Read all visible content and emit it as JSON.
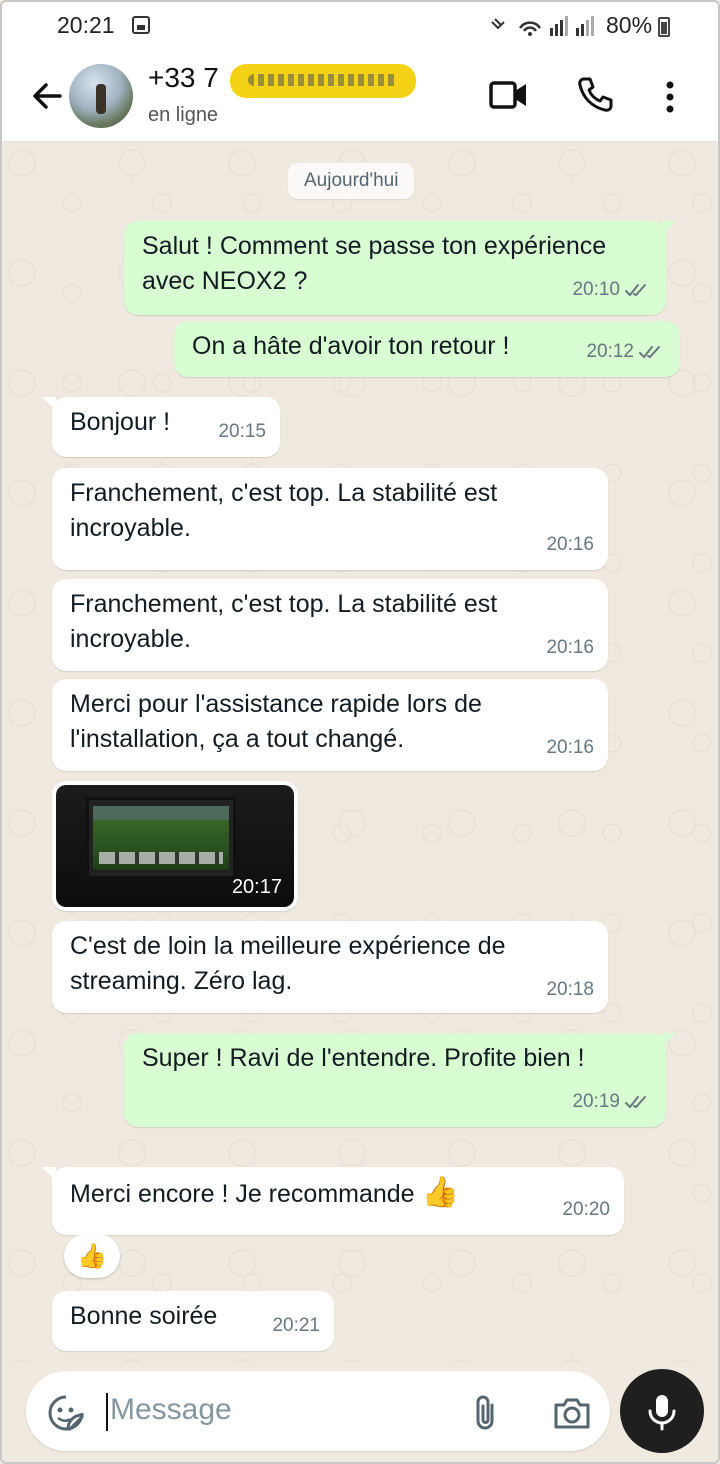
{
  "status_bar": {
    "time": "20:21",
    "battery_pct": "80%",
    "icons": [
      "gallery-icon",
      "mute-icon",
      "wifi-icon",
      "signal-icon",
      "battery-icon"
    ]
  },
  "header": {
    "contact_prefix": "+33 7",
    "status": "en ligne",
    "icons": [
      "back-arrow-icon",
      "video-call-icon",
      "phone-call-icon",
      "more-options-icon"
    ]
  },
  "chat": {
    "date_separator": "Aujourd'hui",
    "messages": [
      {
        "direction": "out",
        "text": "Salut ! Comment se passe ton expérience avec NEOX2 ?",
        "time": "20:10",
        "status": "read"
      },
      {
        "direction": "out",
        "text": "On a hâte d'avoir ton retour !",
        "time": "20:12",
        "status": "read"
      },
      {
        "direction": "in",
        "text": "Bonjour !",
        "time": "20:15"
      },
      {
        "direction": "in",
        "text": "Franchement, c'est top. La stabilité est incroyable.",
        "time": "20:16"
      },
      {
        "direction": "in",
        "text": "Franchement, c'est top. La stabilité est incroyable.",
        "time": "20:16"
      },
      {
        "direction": "in",
        "text": "Merci pour l'assistance rapide lors de l'installation, ça a tout changé.",
        "time": "20:16"
      },
      {
        "direction": "in",
        "type": "image",
        "time": "20:17"
      },
      {
        "direction": "in",
        "text": "C'est de loin la meilleure expérience de streaming. Zéro lag.",
        "time": "20:18"
      },
      {
        "direction": "out",
        "text": "Super ! Ravi de l'entendre. Profite bien !",
        "time": "20:19",
        "status": "read"
      },
      {
        "direction": "in",
        "text": "Merci encore ! Je recommande",
        "emoji": "👍",
        "time": "20:20",
        "reaction": "👍"
      },
      {
        "direction": "in",
        "text": "Bonne soirée",
        "time": "20:21"
      }
    ]
  },
  "input": {
    "placeholder": "Message",
    "icons": [
      "sticker-icon",
      "attach-icon",
      "camera-icon",
      "mic-icon"
    ]
  },
  "colors": {
    "outgoing_bubble": "#d9fdd3",
    "incoming_bubble": "#ffffff",
    "read_ticks": "#53bdeb",
    "wallpaper": "#efe9e0"
  }
}
